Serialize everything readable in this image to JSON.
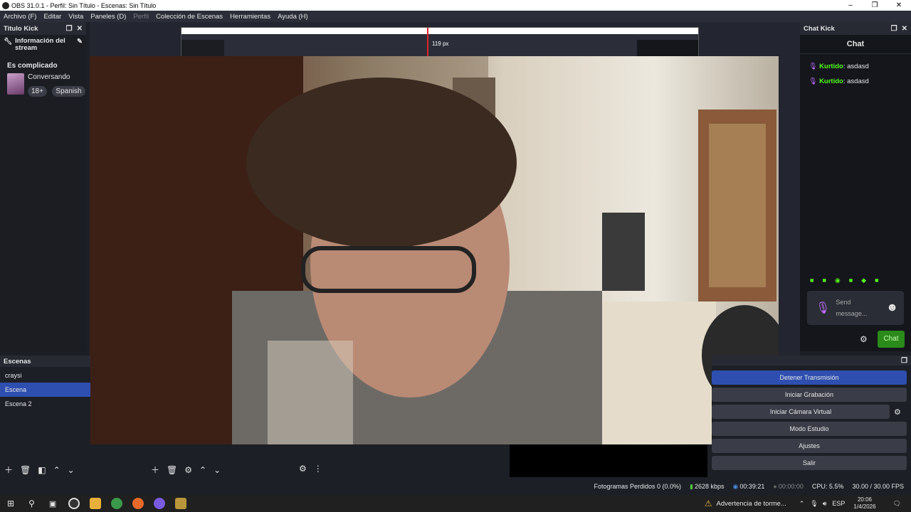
{
  "window": {
    "title": "OBS 31.0.1 - Perfil: Sin Título - Escenas: Sin Título",
    "controls": [
      "–",
      "❐",
      "✕"
    ]
  },
  "menu": [
    {
      "label": "Archivo (F)",
      "enabled": true
    },
    {
      "label": "Editar",
      "enabled": true
    },
    {
      "label": "Vista",
      "enabled": true
    },
    {
      "label": "Paneles (D)",
      "enabled": true
    },
    {
      "label": "Perfil",
      "enabled": false
    },
    {
      "label": "Colección de Escenas",
      "enabled": true
    },
    {
      "label": "Herramientas",
      "enabled": true
    },
    {
      "label": "Ayuda (H)",
      "enabled": true
    }
  ],
  "left_dock": {
    "title": "Titulo Kick",
    "section_label": "Información del stream",
    "stream_title": "Es complicado",
    "category": "Conversando",
    "badges": [
      "18+",
      "Spanish"
    ]
  },
  "nested_preview": {
    "size_label": "119 px"
  },
  "right_dock": {
    "title": "Chat Kick",
    "header": "Chat",
    "messages": [
      {
        "user": "Kurtido",
        "text": "asdasd"
      },
      {
        "user": "Kurtido",
        "text": "asdasd"
      }
    ],
    "input_placeholder": "Send message...",
    "chat_button": "Chat",
    "accent": "#53fc18"
  },
  "scenes": {
    "title": "Escenas",
    "items": [
      {
        "label": "craysi",
        "selected": false
      },
      {
        "label": "Escena",
        "selected": true
      },
      {
        "label": "Escena 2",
        "selected": false
      }
    ]
  },
  "controls": {
    "buttons": [
      {
        "label": "Detener Transmisión",
        "active": true
      },
      {
        "label": "Iniciar Grabación",
        "active": false
      },
      {
        "label": "Iniciar Cámara Virtual",
        "active": false
      },
      {
        "label": "Modo Estudio",
        "active": false
      },
      {
        "label": "Ajustes",
        "active": false
      },
      {
        "label": "Salir",
        "active": false
      }
    ]
  },
  "status": {
    "dropped_frames": "Fotogramas Perdidos 0 (0.0%)",
    "bitrate": "2628 kbps",
    "stream_time": "00:39:21",
    "record_time": "00:00:00",
    "cpu": "CPU: 5.5%",
    "fps": "30.00 / 30.00 FPS"
  },
  "taskbar": {
    "notification": "Advertencia de torme...",
    "language": "ESP",
    "time": "20:06",
    "date": "1/4/2026"
  }
}
